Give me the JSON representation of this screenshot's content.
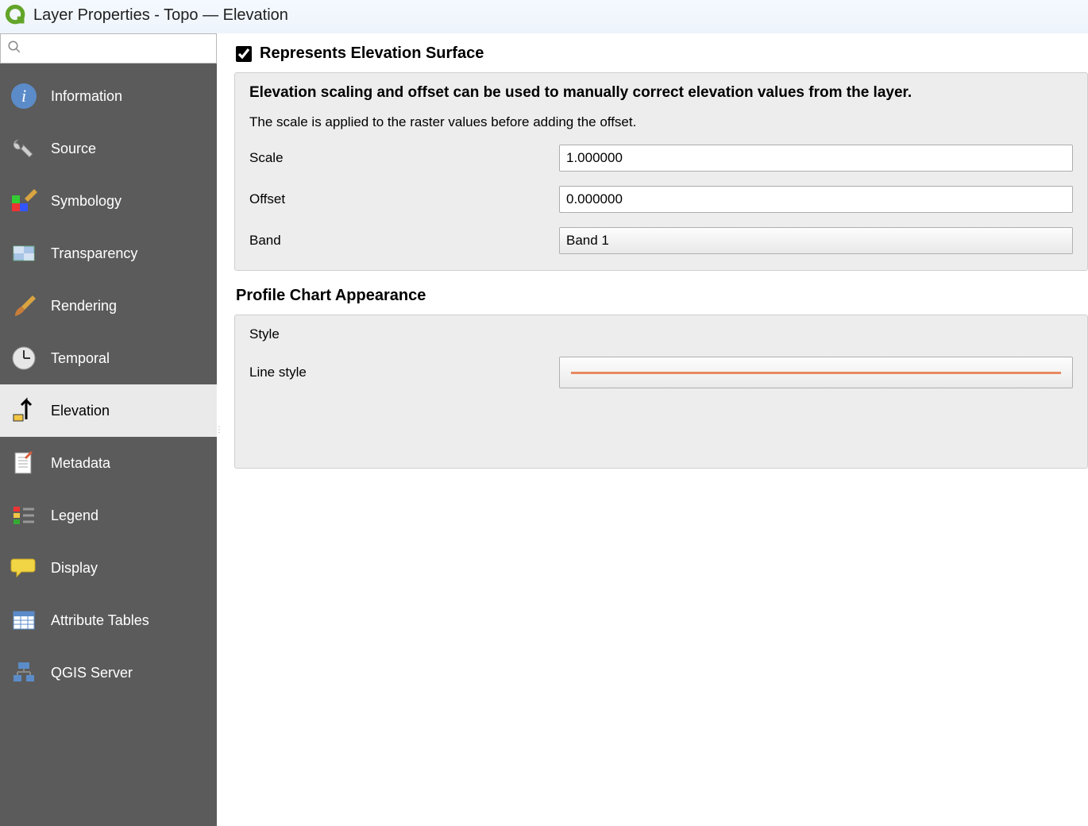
{
  "window": {
    "title": "Layer Properties - Topo — Elevation"
  },
  "sidebar": {
    "search_placeholder": "",
    "items": [
      {
        "label": "Information",
        "id": "information"
      },
      {
        "label": "Source",
        "id": "source"
      },
      {
        "label": "Symbology",
        "id": "symbology"
      },
      {
        "label": "Transparency",
        "id": "transparency"
      },
      {
        "label": "Rendering",
        "id": "rendering"
      },
      {
        "label": "Temporal",
        "id": "temporal"
      },
      {
        "label": "Elevation",
        "id": "elevation",
        "active": true
      },
      {
        "label": "Metadata",
        "id": "metadata"
      },
      {
        "label": "Legend",
        "id": "legend"
      },
      {
        "label": "Display",
        "id": "display"
      },
      {
        "label": "Attribute Tables",
        "id": "attribute-tables"
      },
      {
        "label": "QGIS Server",
        "id": "qgis-server"
      }
    ]
  },
  "elevation": {
    "represents_label": "Represents Elevation Surface",
    "represents_checked": true,
    "scaling_heading": "Elevation scaling and offset can be used to manually correct elevation values from the layer.",
    "scaling_sub": "The scale is applied to the raster values before adding the offset.",
    "scale_label": "Scale",
    "scale_value": "1.000000",
    "offset_label": "Offset",
    "offset_value": "0.000000",
    "band_label": "Band",
    "band_value": "Band 1",
    "profile_heading": "Profile Chart Appearance",
    "style_label": "Style",
    "linestyle_label": "Line style",
    "linestyle_color": "#e8895f"
  }
}
